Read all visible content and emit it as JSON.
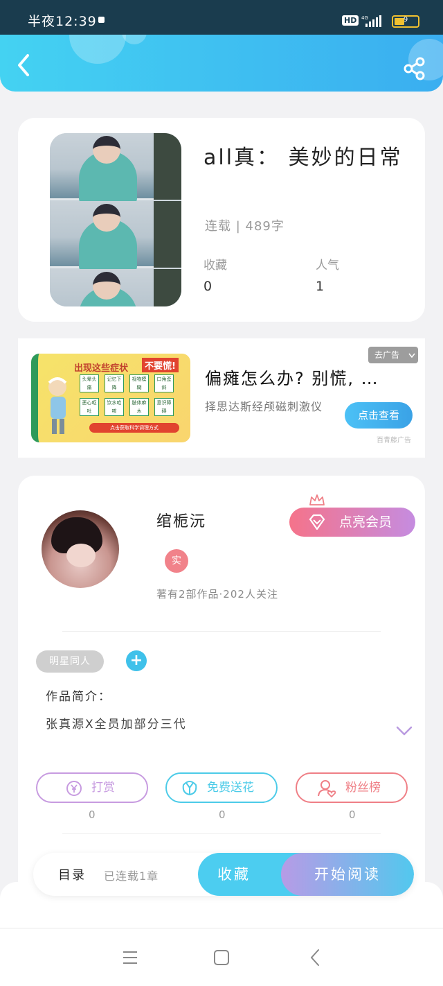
{
  "status_bar": {
    "time": "半夜12:39",
    "network_badge": "HD",
    "battery": "9"
  },
  "header": {
    "back_icon": "chevron-left-icon",
    "share_icon": "share-icon"
  },
  "book": {
    "title": "all真： 美妙的日常",
    "meta": "连载 | 489字",
    "stats": [
      {
        "label": "收藏",
        "value": "0"
      },
      {
        "label": "人气",
        "value": "1"
      }
    ]
  },
  "ad": {
    "image_title": "出现这些症状",
    "image_badge": "不要慌!",
    "symptoms": [
      "头晕头痛",
      "记忆下降",
      "视物模糊",
      "口角歪斜",
      "恶心呕吐",
      "饮水呛咳",
      "肢体麻木",
      "意识障碍"
    ],
    "image_strip": "点击获取科学调理方式",
    "dismiss_label": "去广告",
    "title": "偏瘫怎么办? 别慌, …",
    "description": "择思达斯经颅磁刺激仪",
    "cta": "点击查看",
    "source": "百青藤广告"
  },
  "author": {
    "name": "绾栀沅",
    "verified_badge": "实",
    "meta": "著有2部作品·202人关注",
    "vip_button": "点亮会员"
  },
  "tags": {
    "chip": "明星同人",
    "add_label": "+"
  },
  "intro": {
    "label": "作品简介：",
    "text": "张真源X全员加部分三代"
  },
  "actions": [
    {
      "label": "打赏",
      "count": "0",
      "icon": "yen-icon",
      "color": "#c79be0"
    },
    {
      "label": "免费送花",
      "count": "0",
      "icon": "flower-icon",
      "color": "#4ccbe8"
    },
    {
      "label": "粉丝榜",
      "count": "0",
      "icon": "fans-icon",
      "color": "#ef7f86"
    }
  ],
  "bottom_bar": {
    "toc_label": "目录",
    "toc_status": "已连载1章",
    "favorite_label": "收藏",
    "read_label": "开始阅读"
  },
  "nav_bar": {
    "icons": [
      "menu-icon",
      "home-square-icon",
      "back-triangle-icon"
    ]
  }
}
